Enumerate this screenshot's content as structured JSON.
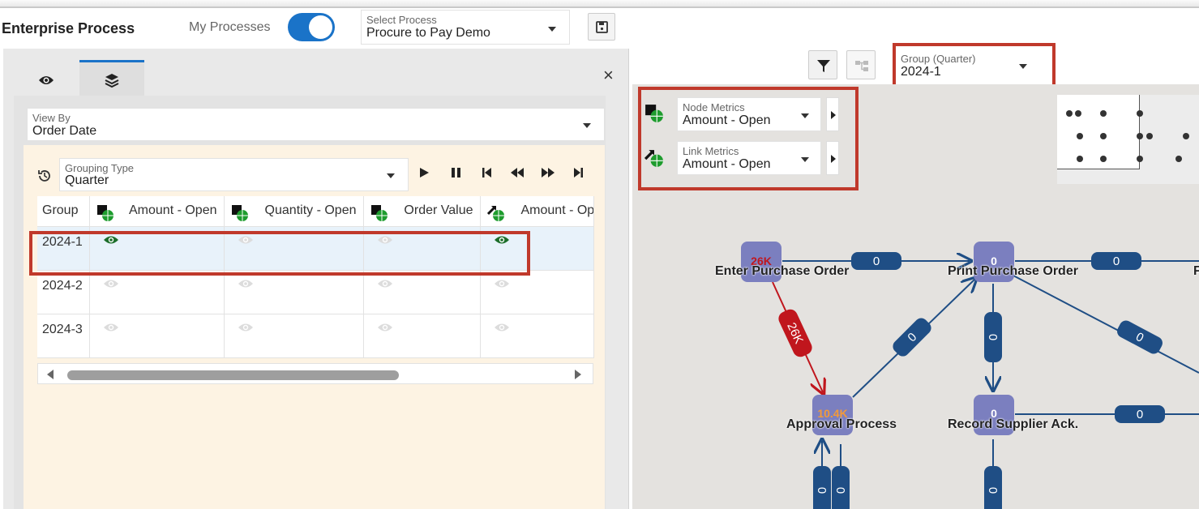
{
  "header": {
    "title": "Enterprise Process",
    "my_processes_label": "My Processes",
    "select_process": {
      "label": "Select Process",
      "value": "Procure to Pay Demo"
    }
  },
  "panel": {
    "view_by": {
      "label": "View By",
      "value": "Order Date"
    },
    "grouping_type": {
      "label": "Grouping Type",
      "value": "Quarter"
    },
    "close_glyph": "×",
    "table": {
      "columns": [
        "Group",
        "Amount - Open",
        "Quantity - Open",
        "Order Value",
        "Amount - Op"
      ],
      "rows": [
        {
          "group": "2024-1",
          "active": [
            true,
            false,
            false,
            true
          ]
        },
        {
          "group": "2024-2",
          "active": [
            false,
            false,
            false,
            false
          ]
        },
        {
          "group": "2024-3",
          "active": [
            false,
            false,
            false,
            false
          ]
        }
      ]
    }
  },
  "graph": {
    "group_selector": {
      "label": "Group (Quarter)",
      "value": "2024-1"
    },
    "node_metrics": {
      "label": "Node Metrics",
      "value": "Amount - Open"
    },
    "link_metrics": {
      "label": "Link Metrics",
      "value": "Amount - Open"
    },
    "nodes": [
      {
        "name": "Enter Purchase Order",
        "value": "26K"
      },
      {
        "name": "Print Purchase Order",
        "value": "0"
      },
      {
        "name": "Approval Process",
        "value": "10.4K"
      },
      {
        "name": "Record Supplier Ack.",
        "value": "0"
      },
      {
        "name": "F",
        "value": ""
      }
    ],
    "links": [
      {
        "value": "0"
      },
      {
        "value": "0"
      },
      {
        "value": "26K"
      },
      {
        "value": "0"
      },
      {
        "value": "0"
      },
      {
        "value": "0"
      },
      {
        "value": "0"
      },
      {
        "value": "0"
      },
      {
        "value": "0"
      },
      {
        "value": "0"
      }
    ]
  },
  "colors": {
    "accent": "#1a73c8",
    "highlight": "#c0392b",
    "node": "#7b7fbf",
    "link": "#1f4e85",
    "critical_link": "#c0161d"
  }
}
